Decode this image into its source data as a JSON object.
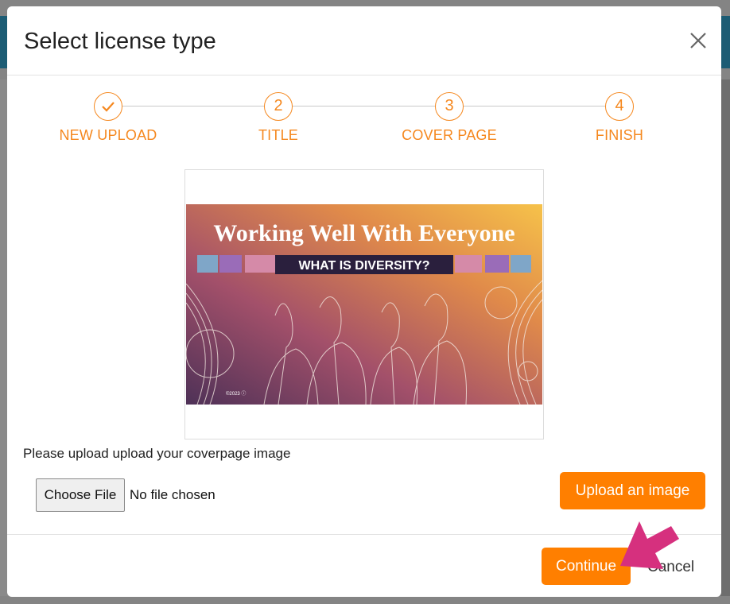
{
  "modal": {
    "title": "Select license type",
    "close_icon": "close-icon"
  },
  "stepper": {
    "steps": [
      {
        "marker": "",
        "icon": "check-icon",
        "label": "NEW UPLOAD"
      },
      {
        "marker": "2",
        "label": "TITLE"
      },
      {
        "marker": "3",
        "label": "COVER PAGE"
      },
      {
        "marker": "4",
        "label": "FINISH"
      }
    ],
    "accent_color": "#f5881f"
  },
  "cover_preview": {
    "headline": "Working Well With Everyone",
    "subtitle": "WHAT IS DIVERSITY?",
    "copyright": "©2023 ⓘ"
  },
  "upload": {
    "hint": "Please upload upload your coverpage image",
    "choose_file_label": "Choose File",
    "file_status": "No file chosen",
    "upload_button_label": "Upload an image"
  },
  "footer": {
    "continue_label": "Continue",
    "cancel_label": "Cancel"
  },
  "colors": {
    "primary_button": "#ff7f00",
    "pointer_arrow": "#d6307e"
  }
}
